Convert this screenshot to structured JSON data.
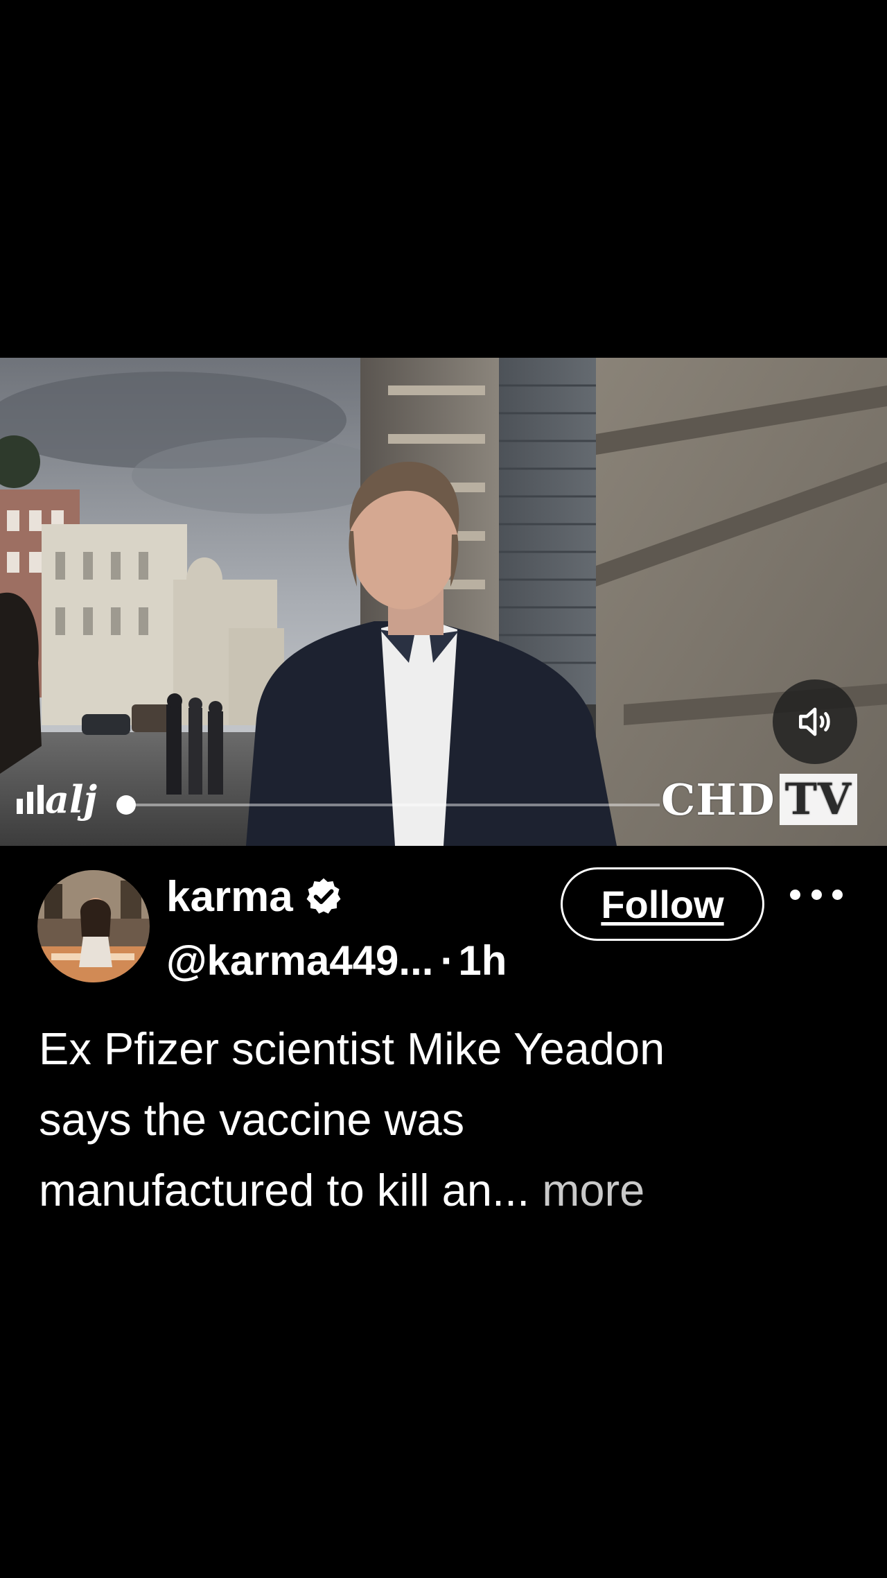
{
  "video": {
    "watermark_main": "CHD",
    "watermark_box": "TV",
    "corner_logo": "alj",
    "mute_icon": "speaker-volume-icon",
    "accent": "#ffffff"
  },
  "post": {
    "display_name": "karma",
    "verified_icon": "verified-badge-icon",
    "handle": "@karma449...",
    "separator": "·",
    "time_ago": "1h",
    "follow_label": "Follow",
    "more_icon": "more-options-icon",
    "caption_line1": "Ex Pfizer scientist Mike Yeadon",
    "caption_line2": "says the vaccine was",
    "caption_line3": "manufactured to kill an...",
    "caption_more": "more"
  },
  "colors": {
    "background": "#000000",
    "text": "#ffffff",
    "muted_text": "#c9c9c9"
  }
}
